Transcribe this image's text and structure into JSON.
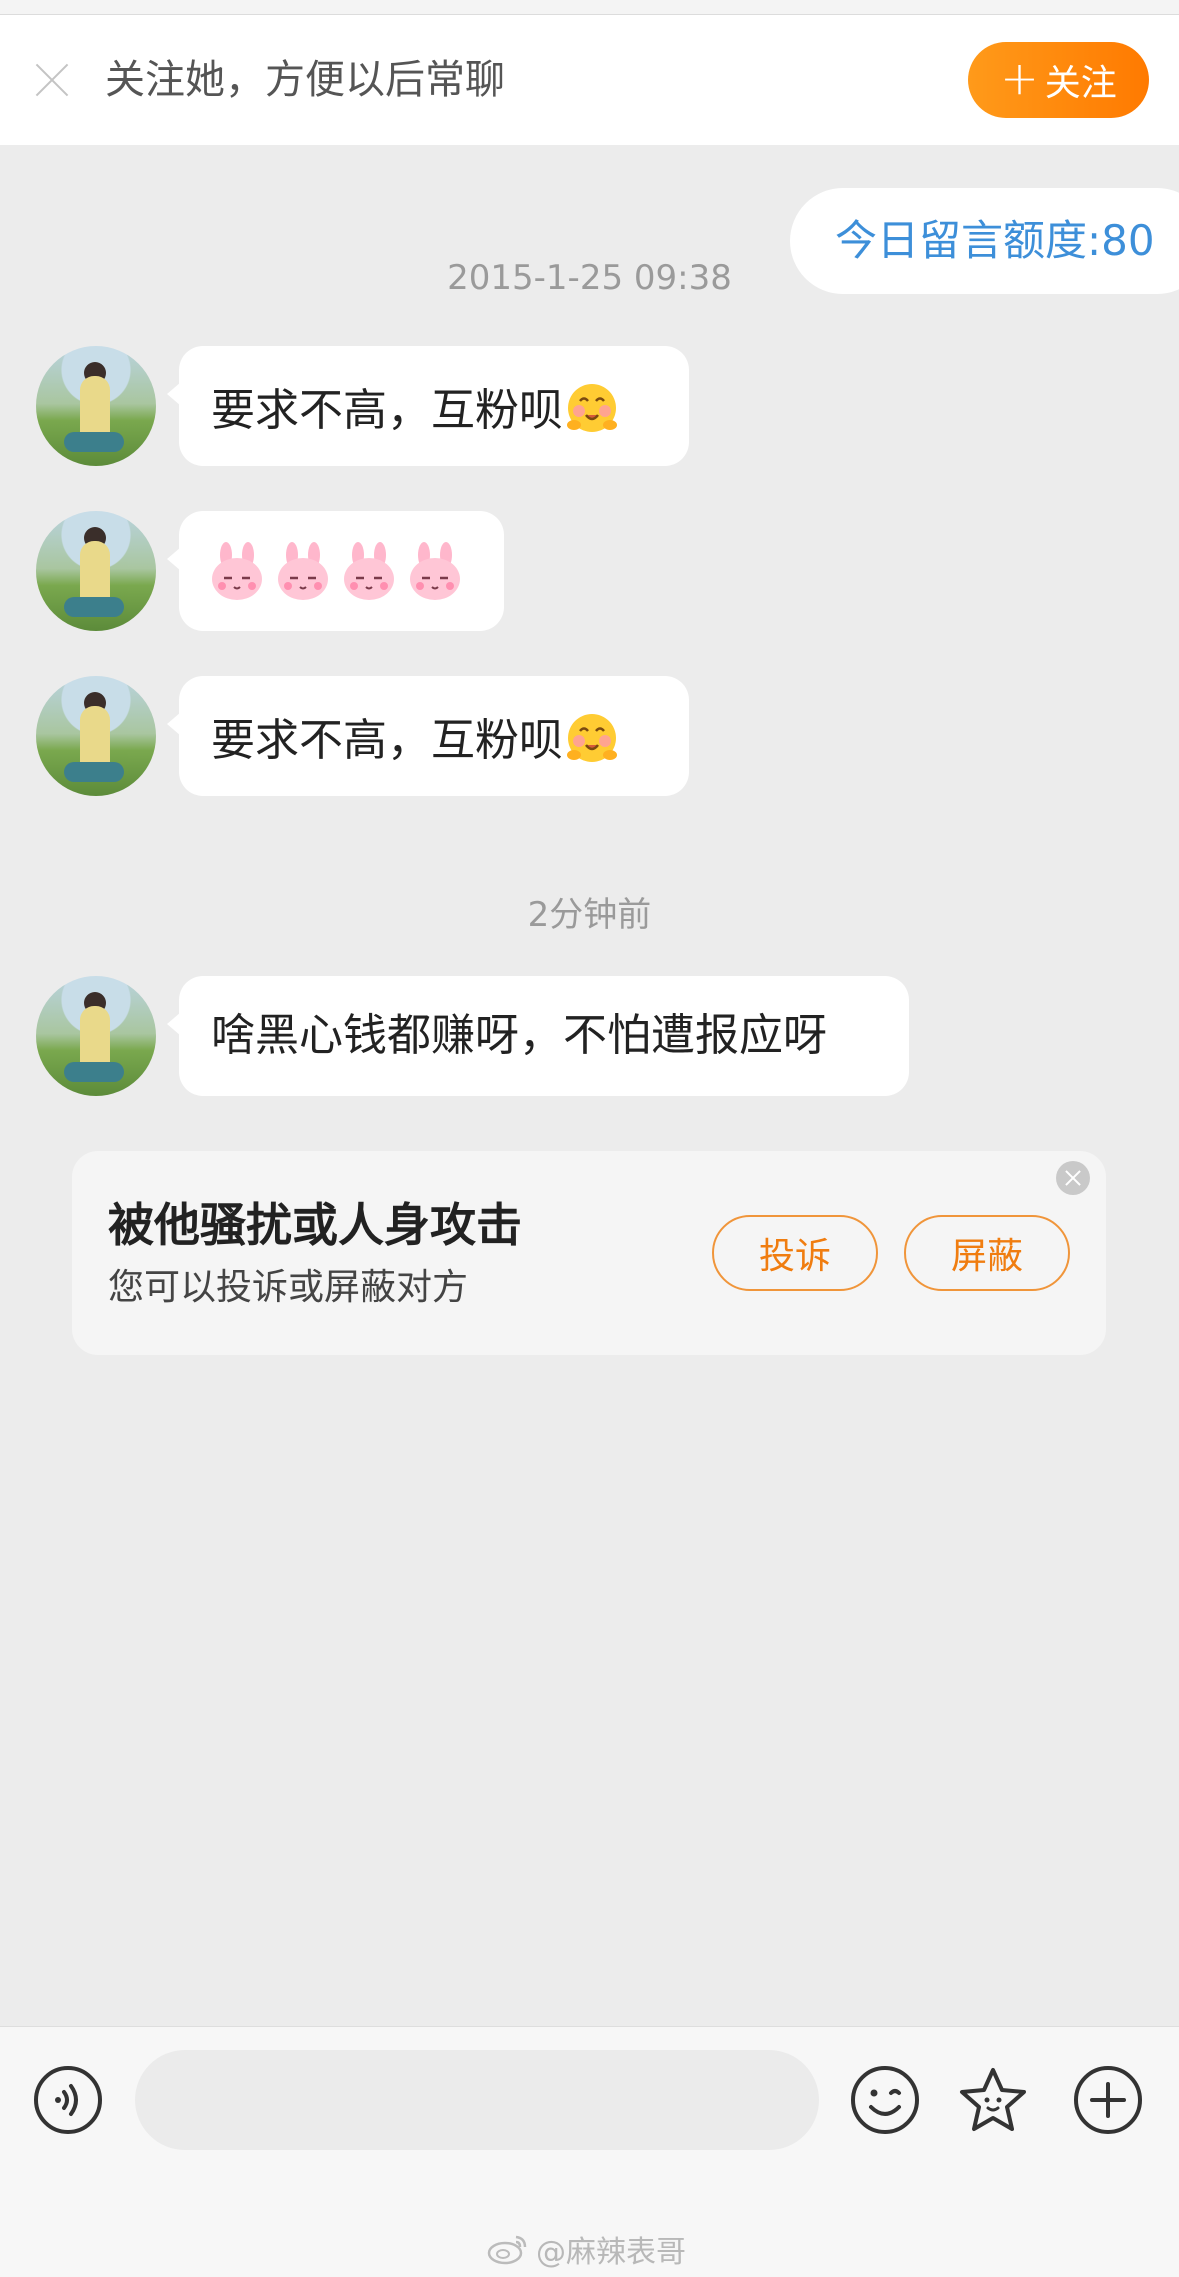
{
  "follow_bar": {
    "prompt": "关注她，方便以后常聊",
    "button_label": "关注",
    "button_plus": "+"
  },
  "quota": {
    "text": "今日留言额度:80"
  },
  "timestamps": [
    "2015-1-25 09:38",
    "2分钟前"
  ],
  "messages": [
    {
      "text": "要求不高，互粉呗",
      "emoji": "hug-emoji"
    },
    {
      "emoji": "bunny-emoji",
      "count": 4
    },
    {
      "text": "要求不高，互粉呗",
      "emoji": "hug-emoji"
    },
    {
      "text": "啥黑心钱都赚呀，不怕遭报应呀"
    }
  ],
  "report_card": {
    "title": "被他骚扰或人身攻击",
    "subtitle": "您可以投诉或屏蔽对方",
    "complain_label": "投诉",
    "block_label": "屏蔽"
  },
  "input_bar": {
    "placeholder": ""
  },
  "watermark": {
    "text": "@麻辣表哥"
  },
  "colors": {
    "accent": "#ff8a0d",
    "link": "#3d8fd9",
    "background": "#ececec"
  }
}
